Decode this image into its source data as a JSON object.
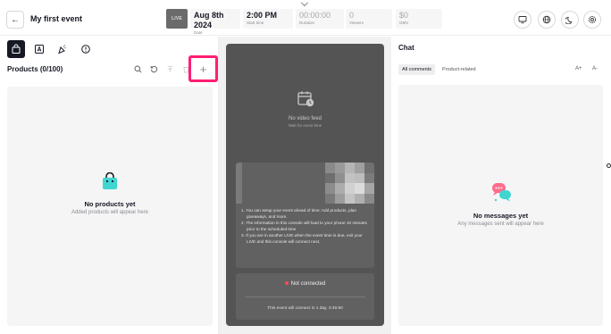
{
  "header": {
    "event_title": "My first event",
    "thumbnail_label": "LIVE",
    "stats": [
      {
        "value": "Aug 8th 2024",
        "label": "Date"
      },
      {
        "value": "2:00 PM",
        "label": "Start time"
      },
      {
        "value": "00:00:00",
        "label": "Duration"
      },
      {
        "value": "0",
        "label": "Viewers"
      },
      {
        "value": "$0",
        "label": "GMV"
      }
    ],
    "icons": [
      "monitor-icon",
      "globe-icon",
      "moon-icon",
      "settings-icon"
    ]
  },
  "products": {
    "header": "Products (0/100)",
    "empty_title": "No products yet",
    "empty_subtitle": "Added products will appear here",
    "add_label": "+"
  },
  "preview": {
    "no_feed_title": "No video feed",
    "no_feed_subtitle": "Wait for event time",
    "info": [
      "1. You can setup your event ahead of time: Add products, plan giveaways, and more.",
      "2. The information in this console will load to your phone 10 minutes prior to the scheduled time",
      "3. If you are in another LIVE when the event time is due, exit your LIVE and this console will connect next."
    ],
    "status": "Not connected",
    "connect_note": "This event will connect in 1 day, 3:45:50"
  },
  "chat": {
    "title": "Chat",
    "tabs": [
      "All comments",
      "Product-related"
    ],
    "font_increase": "A+",
    "font_decrease": "A-",
    "empty_title": "No messages yet",
    "empty_subtitle": "Any messages sent will appear here"
  },
  "colors": {
    "accent_highlight": "#ff1f73",
    "product_icon": "#3fd6d0",
    "status_dot": "#ff4a5a"
  }
}
